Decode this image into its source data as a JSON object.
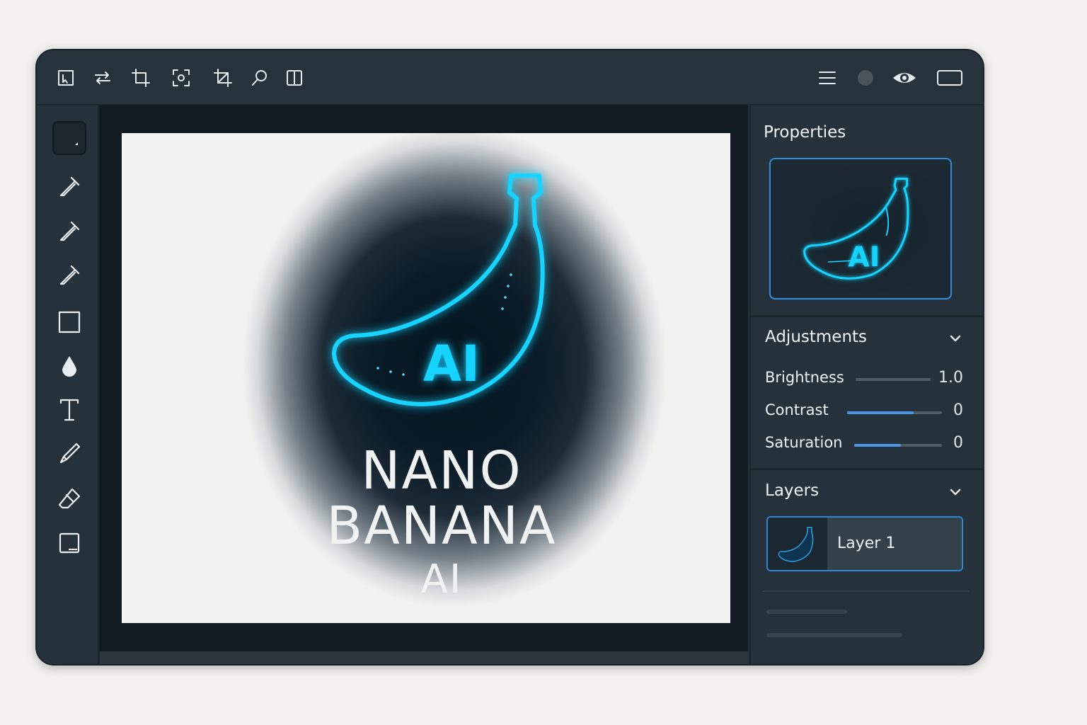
{
  "toolbar_top": {
    "left_icons": [
      "select-icon",
      "swap-icon",
      "crop-icon",
      "focus-icon",
      "crop-alt-icon",
      "search-icon",
      "split-view-icon"
    ],
    "right_icons": [
      "menu-icon",
      "status-dot-icon",
      "eye-icon",
      "window-icon"
    ]
  },
  "tools": [
    "canvas-tool-icon",
    "eyedropper-icon",
    "eyedropper-icon",
    "eyedropper-icon",
    "rectangle-icon",
    "drop-icon",
    "text-icon",
    "brush-icon",
    "eraser-icon",
    "frame-icon"
  ],
  "canvas": {
    "logo_text": "AI",
    "title_line1": "NANO",
    "title_line2": "BANANA",
    "title_line3": "AI",
    "accent_color": "#19d3ff"
  },
  "properties": {
    "title": "Properties",
    "thumb_text": "AI"
  },
  "adjustments": {
    "title": "Adjustments",
    "items": [
      {
        "label": "Brightness",
        "value": "1.0",
        "level": 0
      },
      {
        "label": "Contrast",
        "value": "0",
        "level": 0.7
      },
      {
        "label": "Saturation",
        "value": "0",
        "level": 0.53
      }
    ]
  },
  "layers": {
    "title": "Layers",
    "items": [
      {
        "name": "Layer 1"
      }
    ]
  }
}
